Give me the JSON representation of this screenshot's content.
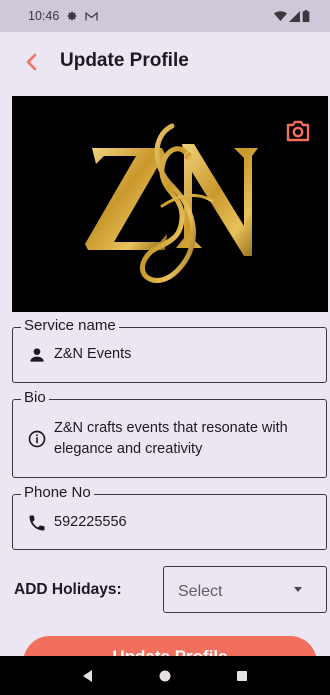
{
  "status_bar": {
    "time": "10:46",
    "icons": [
      "settings-icon",
      "gmail-icon",
      "wifi-icon",
      "cell-signal-icon",
      "battery-icon"
    ]
  },
  "app_bar": {
    "title": "Update Profile",
    "back_icon": "chevron-left-icon",
    "accent": "#f26f5d"
  },
  "banner": {
    "logo_text": "Z&N",
    "camera_icon": "camera-icon"
  },
  "form": {
    "service_name": {
      "label": "Service name",
      "value": "Z&N Events",
      "icon": "person-icon"
    },
    "bio": {
      "label": "Bio",
      "value_line1": "Z&N crafts events that resonate with",
      "value_line2": "elegance and creativity",
      "icon": "info-icon"
    },
    "phone": {
      "label": "Phone No",
      "value": "592225556",
      "icon": "phone-icon"
    },
    "holidays": {
      "label": "ADD Holidays:",
      "select_value": "Select"
    }
  },
  "actions": {
    "update_label": "Update Profile"
  },
  "nav_bar": {
    "icons": [
      "back-triangle-icon",
      "home-circle-icon",
      "recents-square-icon"
    ]
  }
}
